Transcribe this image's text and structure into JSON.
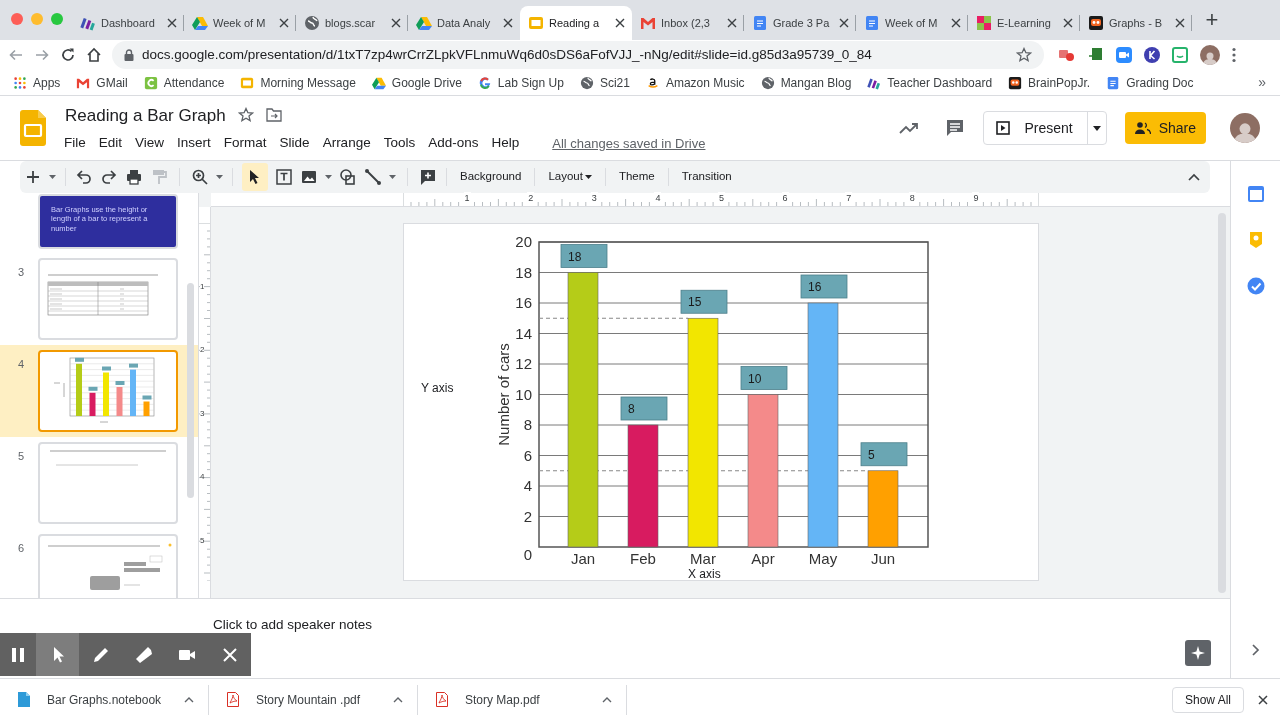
{
  "browser": {
    "tabs": [
      {
        "kind": "stripes",
        "label": "Dashboard",
        "selected": false
      },
      {
        "kind": "drive",
        "label": "Week of M",
        "selected": false
      },
      {
        "kind": "globe",
        "label": "blogs.scar",
        "selected": false
      },
      {
        "kind": "drive",
        "label": "Data Analy",
        "selected": false
      },
      {
        "kind": "slides",
        "label": "Reading a",
        "selected": true
      },
      {
        "kind": "gmail",
        "label": "Inbox (2,3",
        "selected": false
      },
      {
        "kind": "docs",
        "label": "Grade 3 Pa",
        "selected": false
      },
      {
        "kind": "docs",
        "label": "Week of M",
        "selected": false
      },
      {
        "kind": "elearning",
        "label": "E-Learning",
        "selected": false
      },
      {
        "kind": "brainpop",
        "label": "Graphs - B",
        "selected": false
      }
    ],
    "new_tab": "+",
    "url": "docs.google.com/presentation/d/1txT7zp4wrCrrZLpkVFLnmuWq6d0sDS6aFofVJJ_-nNg/edit#slide=id.g85d3a95739_0_84",
    "bookmarks": [
      {
        "kind": "apps",
        "label": "Apps"
      },
      {
        "kind": "gmail",
        "label": "GMail"
      },
      {
        "kind": "c",
        "label": "Attendance"
      },
      {
        "kind": "slides",
        "label": "Morning Message"
      },
      {
        "kind": "drive",
        "label": "Google Drive"
      },
      {
        "kind": "g",
        "label": "Lab Sign Up"
      },
      {
        "kind": "globe",
        "label": "Sci21"
      },
      {
        "kind": "amazon",
        "label": "Amazon Music"
      },
      {
        "kind": "globe",
        "label": "Mangan Blog"
      },
      {
        "kind": "stripes",
        "label": "Teacher Dashboard"
      },
      {
        "kind": "brainpop",
        "label": "BrainPopJr."
      },
      {
        "kind": "docs",
        "label": "Grading Doc"
      }
    ],
    "more": "»"
  },
  "document": {
    "title": "Reading a Bar Graph",
    "menu": [
      "File",
      "Edit",
      "View",
      "Insert",
      "Format",
      "Slide",
      "Arrange",
      "Tools",
      "Add-ons",
      "Help"
    ],
    "save_status": "All changes saved in Drive",
    "present": "Present",
    "share": "Share"
  },
  "toolbar": {
    "select_tool_selected": true,
    "buttons": [
      {
        "label": "Background",
        "dropdown": false
      },
      {
        "label": "Layout",
        "dropdown": true
      },
      {
        "label": "Theme",
        "dropdown": false
      },
      {
        "label": "Transition",
        "dropdown": false
      }
    ]
  },
  "filmstrip": [
    {
      "kind": "title",
      "text": "Bar Graphs use the height or length of a bar to represent a number",
      "selected": false
    },
    {
      "kind": "table",
      "number": "3",
      "selected": false
    },
    {
      "kind": "chart",
      "number": "4",
      "selected": true
    },
    {
      "kind": "question",
      "number": "5",
      "selected": false
    },
    {
      "kind": "question-bars",
      "number": "6",
      "selected": false
    }
  ],
  "ruler": {
    "horizontal": [
      "1",
      "2",
      "3",
      "4",
      "5",
      "6",
      "7",
      "8",
      "9"
    ],
    "vertical": [
      "1",
      "2",
      "3",
      "4",
      "5"
    ]
  },
  "slide": {
    "y_axis_text": "Y axis",
    "x_axis_text": "X axis",
    "chart_data": {
      "type": "bar",
      "ylabel": "Number of cars",
      "categories": [
        "Jan",
        "Feb",
        "Mar",
        "Apr",
        "May",
        "Jun"
      ],
      "series": [
        {
          "values": [
            18,
            8,
            15,
            10,
            16,
            5
          ]
        }
      ],
      "ylim": [
        0,
        20
      ],
      "yticks": [
        0,
        2,
        4,
        6,
        8,
        10,
        12,
        14,
        16,
        18,
        20
      ],
      "data_labels": true,
      "grid": true,
      "ref_lines": [
        {
          "axis": "y",
          "value": 15
        },
        {
          "axis": "y",
          "value": 5
        }
      ]
    }
  },
  "speaker_notes": {
    "placeholder": "Click to add speaker notes"
  },
  "annotation_toolbar": [
    {
      "kind": "pause",
      "selected": false
    },
    {
      "kind": "pointer",
      "selected": true
    },
    {
      "kind": "pen",
      "selected": false
    },
    {
      "kind": "highlighter",
      "selected": false
    },
    {
      "kind": "camera",
      "selected": false
    },
    {
      "kind": "close",
      "selected": false
    }
  ],
  "downloads": [
    {
      "kind": "doc",
      "name": "Bar Graphs.notebook"
    },
    {
      "kind": "pdf",
      "name": "Story Mountain .pdf"
    },
    {
      "kind": "pdf",
      "name": "Story Map.pdf"
    }
  ],
  "show_all": "Show All"
}
